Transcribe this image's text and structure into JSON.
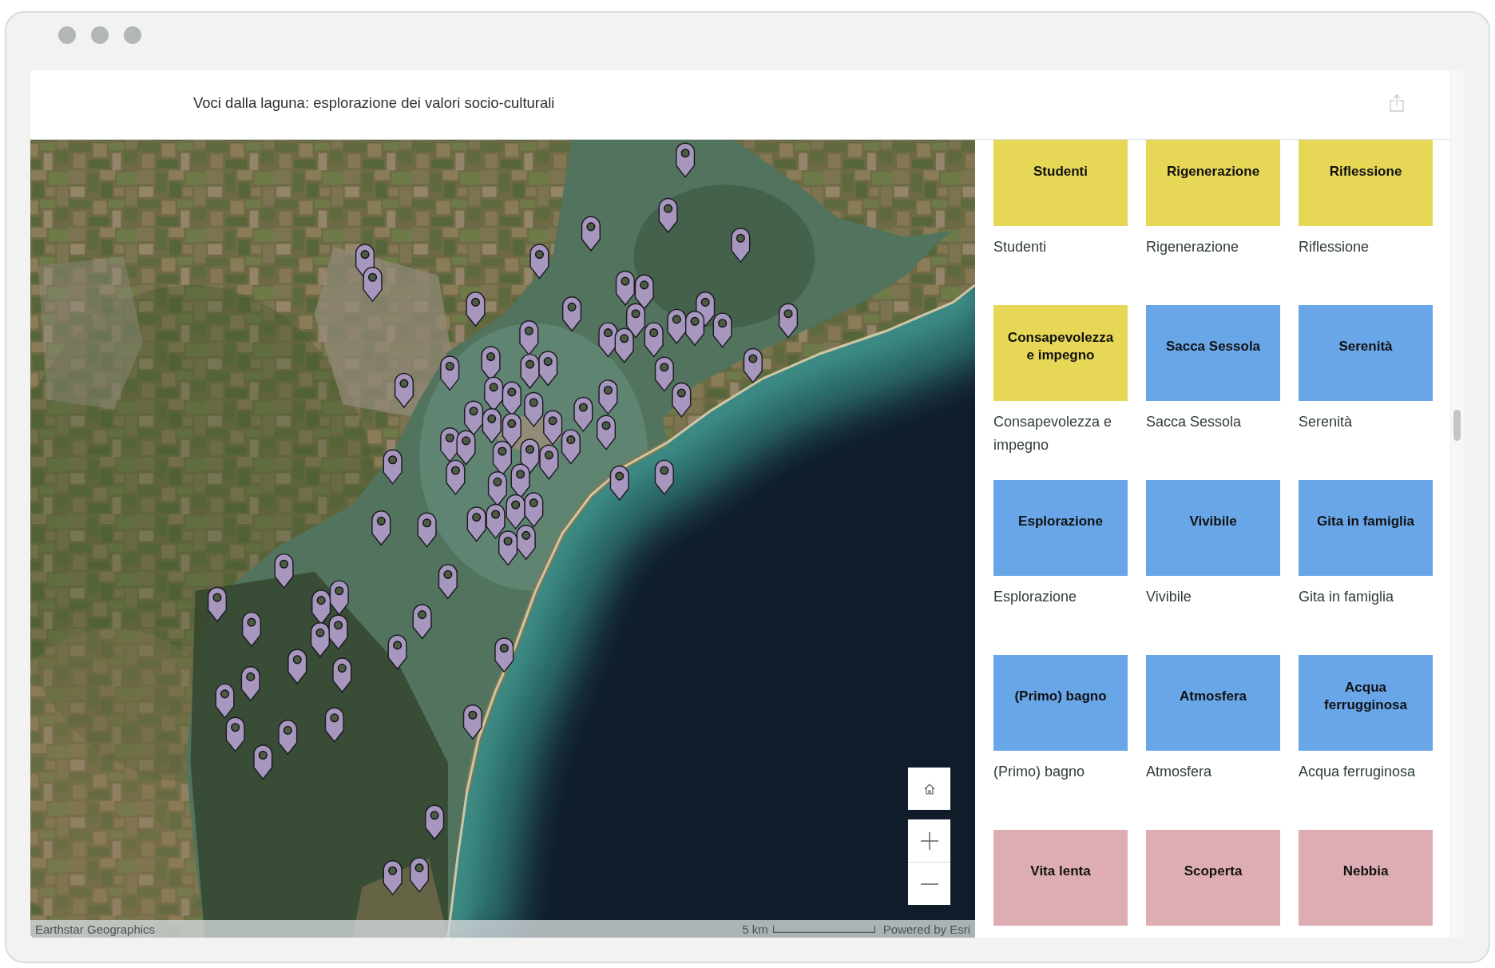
{
  "header": {
    "title": "Voci dalla laguna: esplorazione dei valori socio-culturali"
  },
  "map": {
    "imagery_credit": "Earthstar Geographics",
    "scale_label": "5 km",
    "powered_by": "Powered by Esri"
  },
  "gallery": {
    "items": [
      {
        "label": "Studenti",
        "caption": "Studenti",
        "color": "#e6d757"
      },
      {
        "label": "Rigenerazione",
        "caption": "Rigenerazione",
        "color": "#e6d757"
      },
      {
        "label": "Riflessione",
        "caption": "Riflessione",
        "color": "#e6d757"
      },
      {
        "label": "Consapevolezza e impegno",
        "caption": "Consapevolezza e impegno",
        "color": "#e6d757"
      },
      {
        "label": "Sacca Sessola",
        "caption": "Sacca Sessola",
        "color": "#68a6e8"
      },
      {
        "label": "Serenità",
        "caption": "Serenità",
        "color": "#68a6e8"
      },
      {
        "label": "Esplorazione",
        "caption": "Esplorazione",
        "color": "#68a6e8"
      },
      {
        "label": "Vivibile",
        "caption": "Vivibile",
        "color": "#68a6e8"
      },
      {
        "label": "Gita in famiglia",
        "caption": "Gita in famiglia",
        "color": "#68a6e8"
      },
      {
        "label": "(Primo) bagno",
        "caption": "(Primo) bagno",
        "color": "#68a6e8"
      },
      {
        "label": "Atmosfera",
        "caption": "Atmosfera",
        "color": "#68a6e8"
      },
      {
        "label": "Acqua ferrugginosa",
        "caption": "Acqua ferruginosa",
        "color": "#68a6e8"
      },
      {
        "label": "Vita lenta",
        "color": "#ddadb3"
      },
      {
        "label": "Scoperta",
        "color": "#ddadb3"
      },
      {
        "label": "Nebbia",
        "color": "#ddadb3"
      }
    ]
  }
}
